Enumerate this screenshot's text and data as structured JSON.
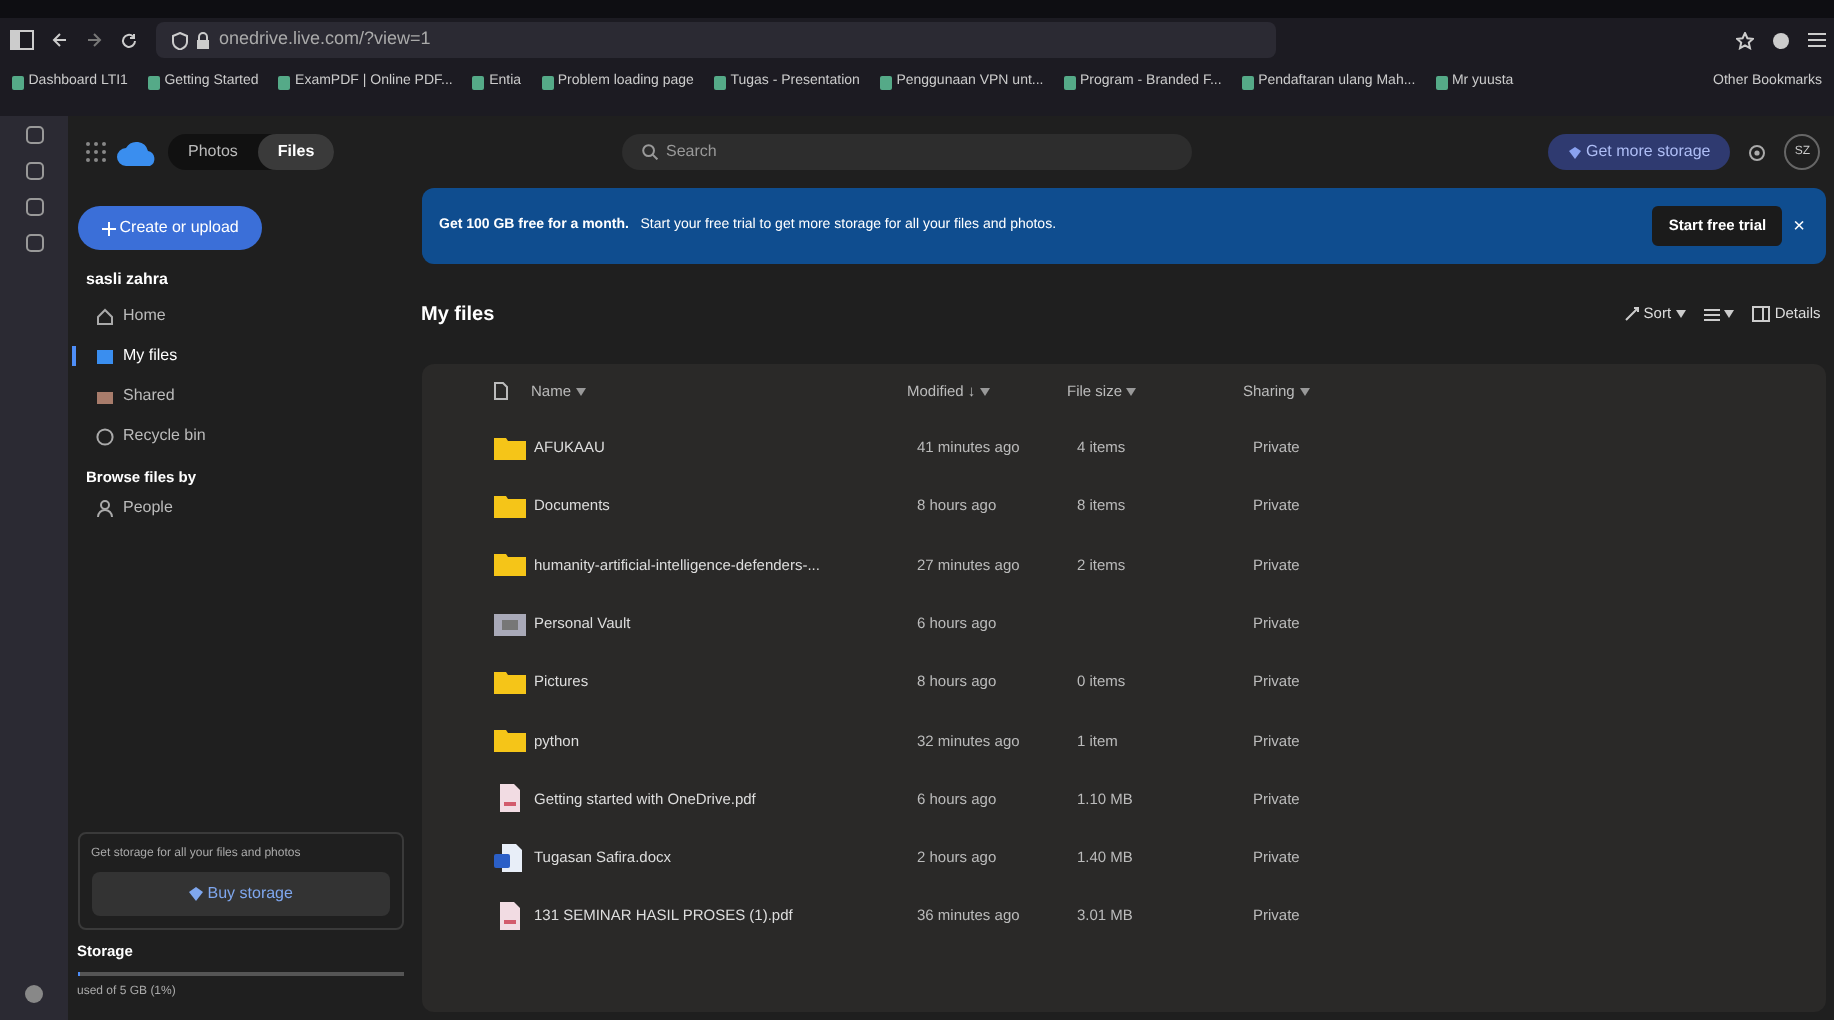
{
  "browser": {
    "url": "onedrive.live.com/?view=1",
    "bookmarks": [
      "Dashboard LTI1",
      "Getting Started",
      "ExamPDF | Online PDF...",
      "Entia",
      "Problem loading page",
      "Tugas - Presentation",
      "Penggunaan VPN unt...",
      "Program - Branded F...",
      "Pendaftaran ulang Mah...",
      "Mr yuusta"
    ],
    "other_bookmarks": "Other Bookmarks"
  },
  "app": {
    "tabs": [
      {
        "label": "Photos",
        "selected": false
      },
      {
        "label": "Files",
        "selected": true
      }
    ],
    "search": {
      "placeholder": "Search"
    },
    "get_storage": "Get more storage",
    "avatar": "SZ"
  },
  "sidebar": {
    "create_button": "Create or upload",
    "user": "sasli zahra",
    "items": [
      {
        "label": "Home",
        "kind": "home",
        "selected": false
      },
      {
        "label": "My files",
        "kind": "folder",
        "selected": true
      },
      {
        "label": "Shared",
        "kind": "people",
        "selected": false
      },
      {
        "label": "Recycle bin",
        "kind": "bin",
        "selected": false
      }
    ],
    "browse_heading": "Browse files by",
    "browse_items": [
      {
        "label": "People",
        "kind": "person"
      }
    ],
    "promo": "Get storage for all your files and photos",
    "buy_button": "Buy storage",
    "storage": {
      "heading": "Storage",
      "level": 0.01,
      "text": "used of 5 GB (1%)"
    }
  },
  "banner": {
    "bold": "Get 100 GB free for a month.",
    "text": "Start your free trial to get more storage for all your files and photos.",
    "button": "Start free trial",
    "close": "×"
  },
  "heading": "My files",
  "toolbar": [
    "Sort",
    "Details"
  ],
  "table": {
    "columns": [
      "Name",
      "Modified ↓",
      "File size",
      "Sharing"
    ],
    "rows": [
      {
        "kind": "folder",
        "name": "AFUKAAU",
        "modified": "41 minutes ago",
        "size": "4 items",
        "sharing": "Private"
      },
      {
        "kind": "folder",
        "name": "Documents",
        "modified": "8 hours ago",
        "size": "8 items",
        "sharing": "Private"
      },
      {
        "kind": "folder",
        "name": "humanity-artificial-intelligence-defenders-...",
        "modified": "27 minutes ago",
        "size": "2 items",
        "sharing": "Private"
      },
      {
        "kind": "vault",
        "name": "Personal Vault",
        "modified": "6 hours ago",
        "sharing": "Private"
      },
      {
        "kind": "folder",
        "name": "Pictures",
        "modified": "8 hours ago",
        "size": "0 items",
        "sharing": "Private"
      },
      {
        "kind": "folder",
        "name": "python",
        "modified": "32 minutes ago",
        "size": "1 item",
        "sharing": "Private"
      },
      {
        "kind": "pdf",
        "name": "Getting started with OneDrive.pdf",
        "modified": "6 hours ago",
        "size": "1.10 MB",
        "sharing": "Private"
      },
      {
        "kind": "word",
        "name": "Tugasan Safira.docx",
        "modified": "2 hours ago",
        "size": "1.40 MB",
        "sharing": "Private"
      },
      {
        "kind": "pdf",
        "name": "131 SEMINAR HASIL PROSES (1).pdf",
        "modified": "36 minutes ago",
        "size": "3.01 MB",
        "sharing": "Private"
      }
    ]
  }
}
